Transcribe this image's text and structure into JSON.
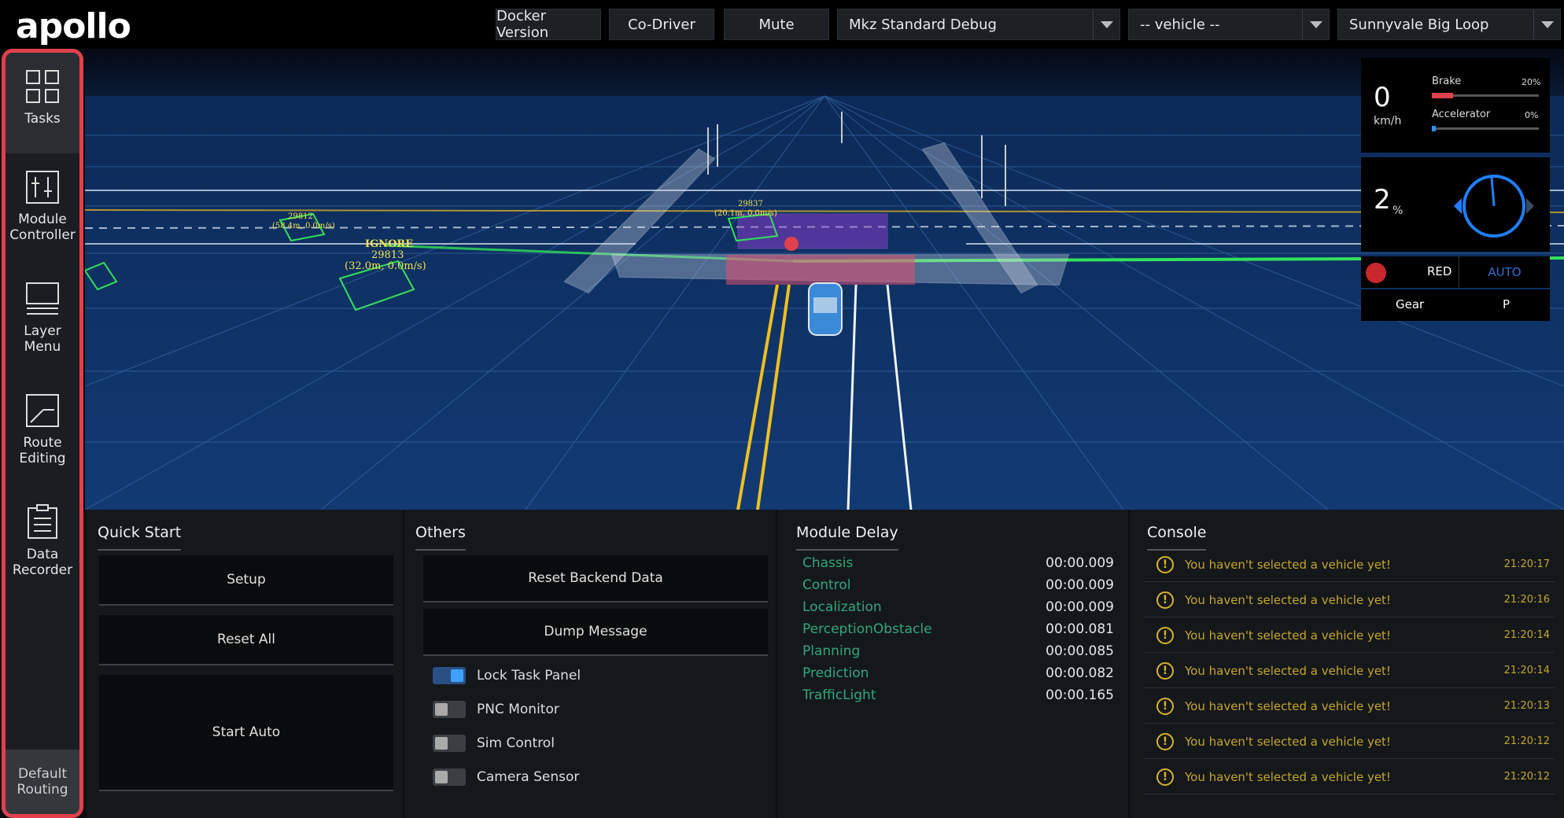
{
  "app": {
    "logo": "apollo"
  },
  "topbar": {
    "docker_version": "Docker Version",
    "co_driver": "Co-Driver",
    "mute": "Mute",
    "mode_select": "Mkz Standard Debug",
    "vehicle_select": "-- vehicle --",
    "map_select": "Sunnyvale Big Loop"
  },
  "sidebar": {
    "items": [
      {
        "label_line1": "Tasks",
        "label_line2": "",
        "icon": "grid-icon"
      },
      {
        "label_line1": "Module",
        "label_line2": "Controller",
        "icon": "sliders-icon"
      },
      {
        "label_line1": "Layer",
        "label_line2": "Menu",
        "icon": "layers-icon"
      },
      {
        "label_line1": "Route",
        "label_line2": "Editing",
        "icon": "route-icon"
      },
      {
        "label_line1": "Data",
        "label_line2": "Recorder",
        "icon": "clipboard-icon"
      }
    ],
    "default_routing_line1": "Default",
    "default_routing_line2": "Routing"
  },
  "scene": {
    "obstacle_ignore_label": "IGNORE",
    "obstacle_ignore_id": "29813",
    "obstacle_ignore_info": "(32.0m, 0.0m/s)",
    "obstacle_left_id": "29812",
    "obstacle_left_info": "(58.4m, 0.0m/s)",
    "obstacle_center_id": "29837",
    "obstacle_center_info": "(20.1m, 0.0m/s)"
  },
  "status": {
    "speed_value": "0",
    "speed_unit": "km/h",
    "brake_label": "Brake",
    "brake_pct": "20%",
    "brake_level": 0.2,
    "accelerator_label": "Accelerator",
    "accelerator_pct": "0%",
    "accelerator_level": 0.0,
    "steering_value": "2",
    "steering_unit": "%",
    "signal_label": "RED",
    "drive_mode": "AUTO",
    "gear_label": "Gear",
    "gear_value": "P",
    "colors": {
      "brake": "#e0414c",
      "accelerator": "#2f8fff",
      "signal": "#c8272d",
      "auto": "#2f6fd6"
    }
  },
  "quick_start": {
    "title": "Quick Start",
    "setup": "Setup",
    "reset_all": "Reset All",
    "start_auto": "Start Auto"
  },
  "others": {
    "title": "Others",
    "reset_backend": "Reset Backend Data",
    "dump_message": "Dump Message",
    "toggles": [
      {
        "label": "Lock Task Panel",
        "on": true
      },
      {
        "label": "PNC Monitor",
        "on": false
      },
      {
        "label": "Sim Control",
        "on": false
      },
      {
        "label": "Camera Sensor",
        "on": false
      }
    ]
  },
  "module_delay": {
    "title": "Module Delay",
    "rows": [
      {
        "name": "Chassis",
        "value": "00:00.009"
      },
      {
        "name": "Control",
        "value": "00:00.009"
      },
      {
        "name": "Localization",
        "value": "00:00.009"
      },
      {
        "name": "PerceptionObstacle",
        "value": "00:00.081"
      },
      {
        "name": "Planning",
        "value": "00:00.085"
      },
      {
        "name": "Prediction",
        "value": "00:00.082"
      },
      {
        "name": "TrafficLight",
        "value": "00:00.165"
      }
    ]
  },
  "console": {
    "title": "Console",
    "rows": [
      {
        "message": "You haven't selected a vehicle yet!",
        "time": "21:20:17"
      },
      {
        "message": "You haven't selected a vehicle yet!",
        "time": "21:20:16"
      },
      {
        "message": "You haven't selected a vehicle yet!",
        "time": "21:20:14"
      },
      {
        "message": "You haven't selected a vehicle yet!",
        "time": "21:20:14"
      },
      {
        "message": "You haven't selected a vehicle yet!",
        "time": "21:20:13"
      },
      {
        "message": "You haven't selected a vehicle yet!",
        "time": "21:20:12"
      },
      {
        "message": "You haven't selected a vehicle yet!",
        "time": "21:20:12"
      }
    ]
  }
}
